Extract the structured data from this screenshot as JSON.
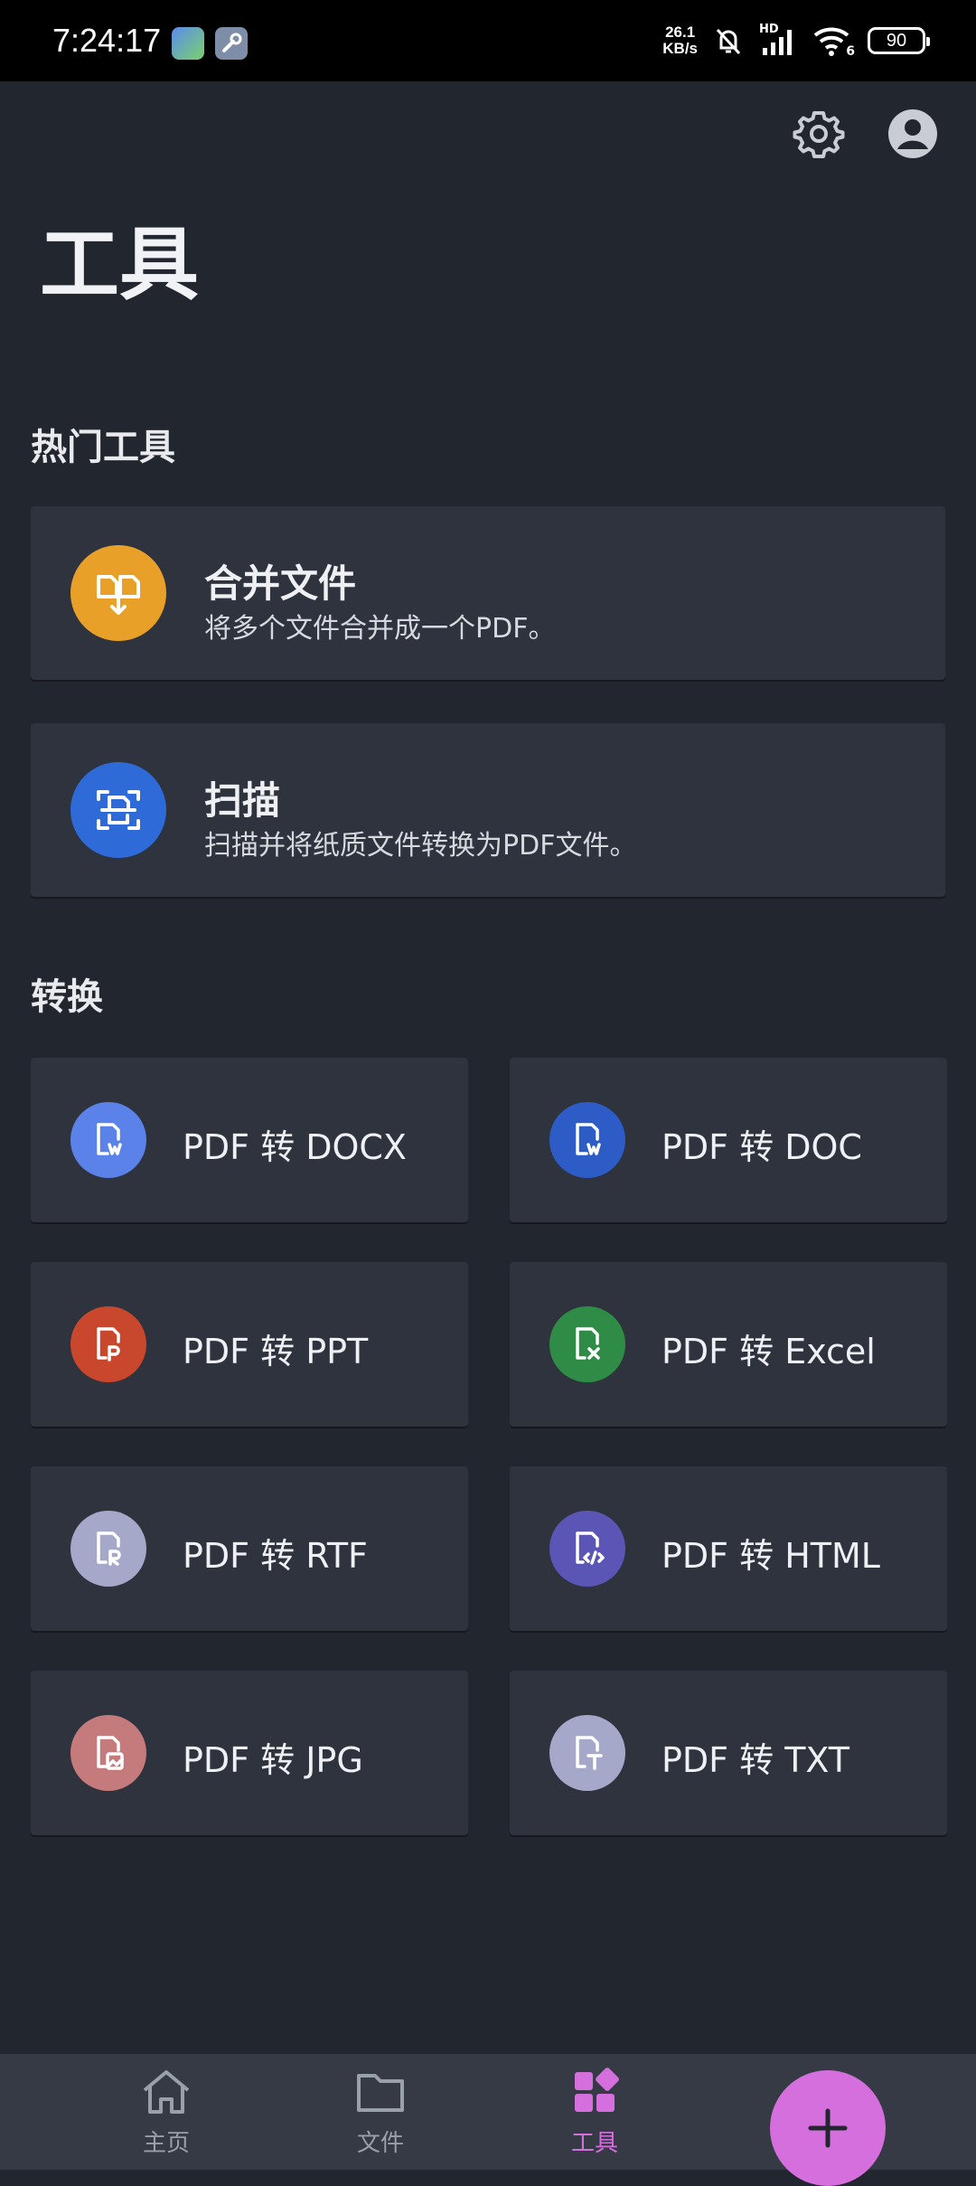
{
  "status_bar": {
    "time": "7:24:17",
    "net_speed_value": "26.1",
    "net_speed_unit": "KB/s",
    "signal_label": "HD",
    "wifi_label": "6",
    "battery": "90",
    "app_icons": [
      "gallery-app-icon",
      "tools-app-icon"
    ]
  },
  "header": {
    "icons": [
      "gear-icon",
      "account-icon"
    ],
    "title": "工具"
  },
  "popular": {
    "heading": "热门工具",
    "items": [
      {
        "title": "合并文件",
        "desc": "将多个文件合并成一个PDF。",
        "color": "#e9a029",
        "icon": "merge-files-icon"
      },
      {
        "title": "扫描",
        "desc": "扫描并将纸质文件转换为PDF文件。",
        "color": "#2f6ad9",
        "icon": "scan-icon"
      }
    ]
  },
  "convert": {
    "heading": "转换",
    "items": [
      {
        "label": "PDF 转 DOCX",
        "color": "#5b82e8",
        "icon": "docx-icon"
      },
      {
        "label": "PDF 转 DOC",
        "color": "#2d5cc7",
        "icon": "doc-icon"
      },
      {
        "label": "PDF 转 PPT",
        "color": "#c9472c",
        "icon": "ppt-icon"
      },
      {
        "label": "PDF 转 Excel",
        "color": "#2f8c47",
        "icon": "excel-icon"
      },
      {
        "label": "PDF 转 RTF",
        "color": "#a6a8c9",
        "icon": "rtf-icon"
      },
      {
        "label": "PDF 转 HTML",
        "color": "#5b55b5",
        "icon": "html-icon"
      },
      {
        "label": "PDF 转 JPG",
        "color": "#c57a7b",
        "icon": "jpg-icon"
      },
      {
        "label": "PDF 转 TXT",
        "color": "#a6a8c9",
        "icon": "txt-icon"
      }
    ]
  },
  "bottom_nav": {
    "items": [
      {
        "label": "主页",
        "icon": "home-icon",
        "active": false
      },
      {
        "label": "文件",
        "icon": "folder-icon",
        "active": false
      },
      {
        "label": "工具",
        "icon": "tools-grid-icon",
        "active": true
      }
    ],
    "fab_icon": "plus-icon",
    "accent": "#d46fdd"
  }
}
